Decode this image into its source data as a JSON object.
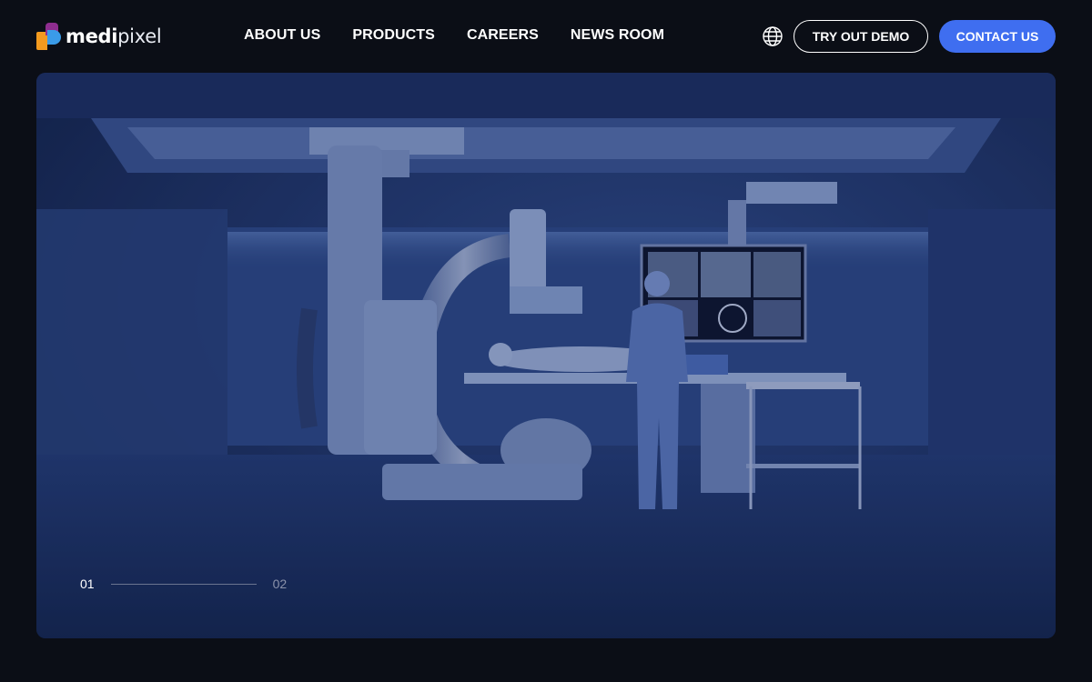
{
  "brand": {
    "name_bold": "medi",
    "name_light": "pixel"
  },
  "nav": {
    "items": [
      "ABOUT US",
      "PRODUCTS",
      "CAREERS",
      "NEWS ROOM"
    ]
  },
  "actions": {
    "language_icon": "globe-icon",
    "demo_label": "TRY OUT DEMO",
    "contact_label": "CONTACT US"
  },
  "hero": {
    "slide_current": "01",
    "slide_next": "02"
  },
  "colors": {
    "background": "#0b0e16",
    "accent": "#3f6ef0",
    "hero_blue": "#233a73"
  }
}
